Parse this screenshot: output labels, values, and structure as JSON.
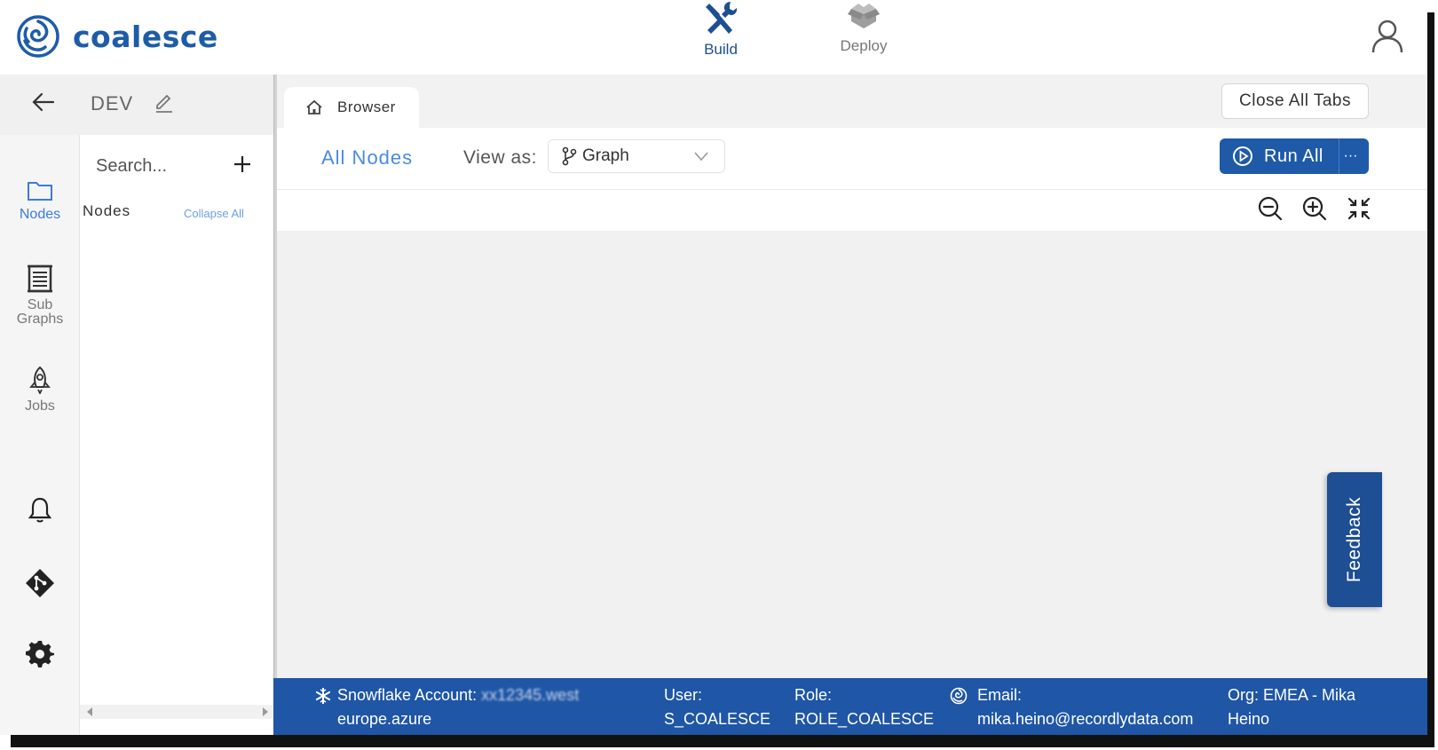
{
  "app": {
    "logo_text": "coalesce",
    "brand_color": "#1d5ca8"
  },
  "topnav": {
    "build_label": "Build",
    "deploy_label": "Deploy",
    "active": "Build"
  },
  "env": {
    "name": "DEV"
  },
  "rail": {
    "nodes_label": "Nodes",
    "subgraphs_label_line1": "Sub",
    "subgraphs_label_line2": "Graphs",
    "jobs_label": "Jobs",
    "icons": [
      "folder-icon",
      "subgraphs-icon",
      "rocket-icon",
      "bell-icon",
      "git-icon",
      "gear-icon"
    ]
  },
  "nodepanel": {
    "search_placeholder": "Search...",
    "title": "Nodes",
    "collapse_all": "Collapse All"
  },
  "tabs": [
    {
      "label": "Browser",
      "icon": "home-icon"
    }
  ],
  "close_all_tabs": "Close All Tabs",
  "toolbar": {
    "all_nodes": "All Nodes",
    "view_as_label": "View as:",
    "view_as_value": "Graph",
    "run_all_label": "Run All",
    "more_label": "···"
  },
  "feedback": {
    "label": "Feedback"
  },
  "statusbar": {
    "snowflake_label": "Snowflake Account:",
    "snowflake_account_obscured": "xx12345.west",
    "snowflake_region": "europe.azure",
    "user_label": "User:",
    "user_value": "S_COALESCE",
    "role_label": "Role:",
    "role_value": "ROLE_COALESCE",
    "email_label": "Email:",
    "email_value": "mika.heino@recordlydata.com",
    "org_line1": "Org: EMEA - Mika",
    "org_line2": "Heino"
  }
}
